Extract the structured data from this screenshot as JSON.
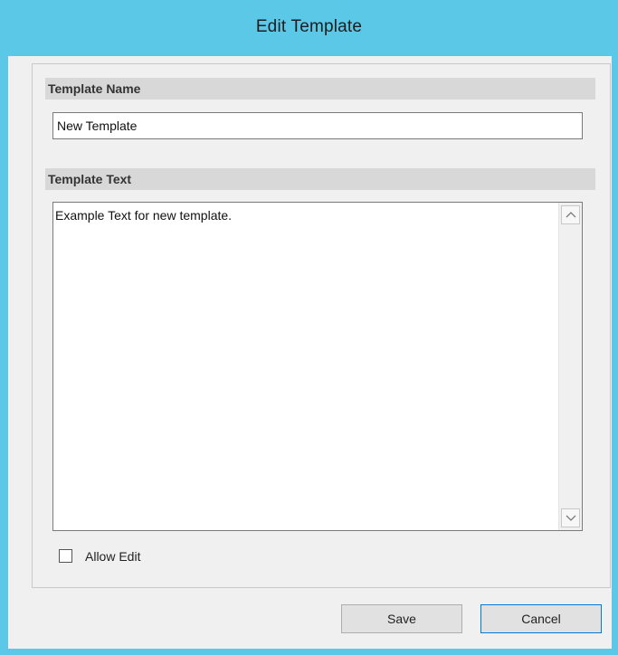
{
  "window": {
    "title": "Edit Template"
  },
  "form": {
    "name_header": "Template Name",
    "name_value": "New Template",
    "text_header": "Template Text",
    "text_value": "Example Text for new template.",
    "allow_edit_label": "Allow Edit",
    "allow_edit_checked": false
  },
  "buttons": {
    "save_label": "Save",
    "cancel_label": "Cancel"
  },
  "colors": {
    "title_bar": "#5bc8e7",
    "client_bg": "#f0f0f0",
    "section_header_bg": "#d8d8d8",
    "focus_border": "#0078d7"
  },
  "icons": {
    "scroll_up": "chevron-up-icon",
    "scroll_down": "chevron-down-icon"
  }
}
